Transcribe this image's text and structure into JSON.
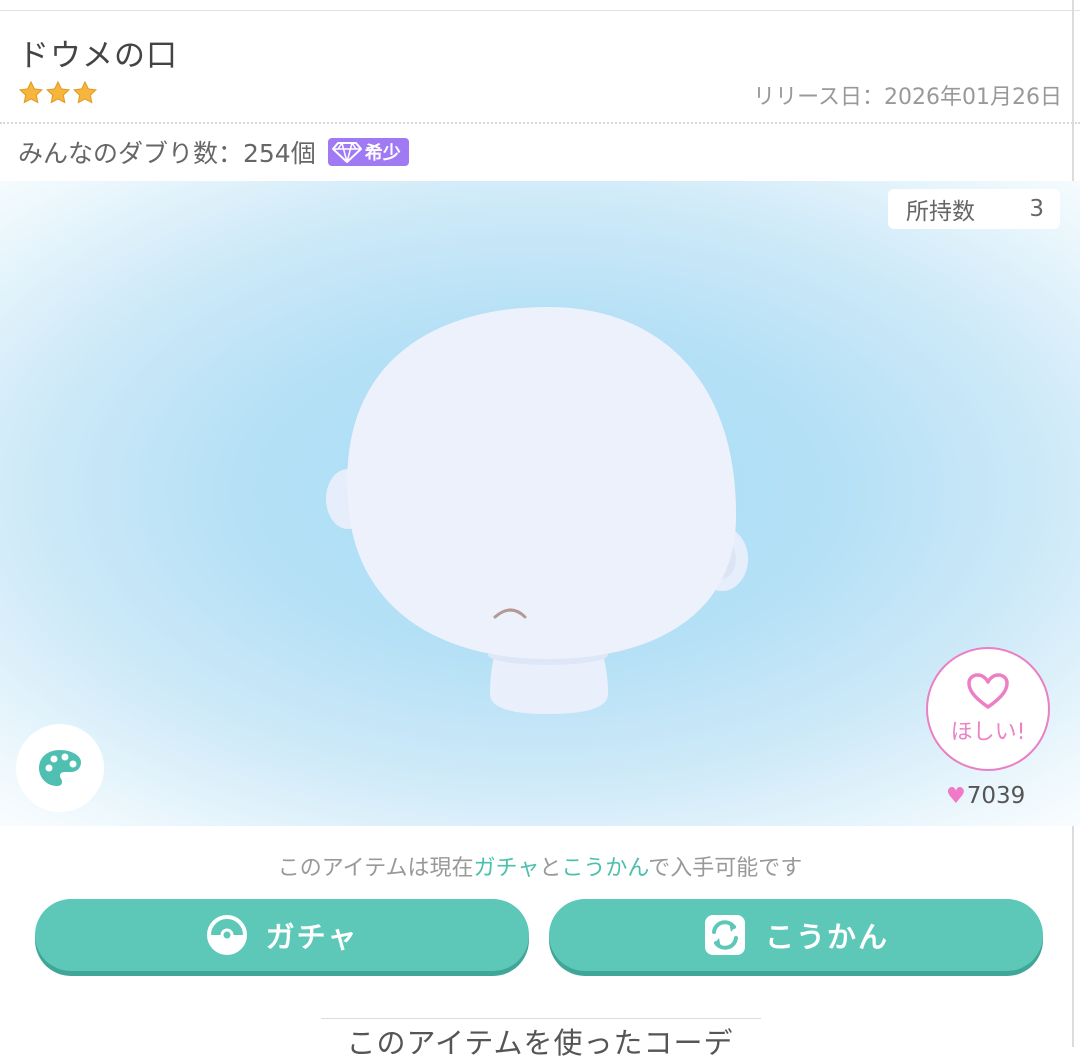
{
  "item": {
    "title": "ドウメの口",
    "stars": 3,
    "release": "リリース日：2026年01月26日",
    "duplicate_label": "みんなのダブり数：254個",
    "rarity_badge": "希少"
  },
  "stage": {
    "owned_label": "所持数",
    "owned_count": "3",
    "want_label": "ほしい!",
    "likes": "7039"
  },
  "availability": {
    "prefix": "このアイテムは現在",
    "gacha": "ガチャ",
    "and": "と",
    "exchange": "こうかん",
    "suffix": "で入手可能です"
  },
  "buttons": {
    "gacha_label": "ガチャ",
    "exchange_label": "こうかん"
  },
  "section": {
    "coordinates_title": "このアイテムを使ったコーデ"
  },
  "colors": {
    "accent_teal": "#5dc8b8",
    "rare_purple": "#9f7af3",
    "want_pink": "#ec7fc6",
    "star_gold": "#f6b63e"
  }
}
